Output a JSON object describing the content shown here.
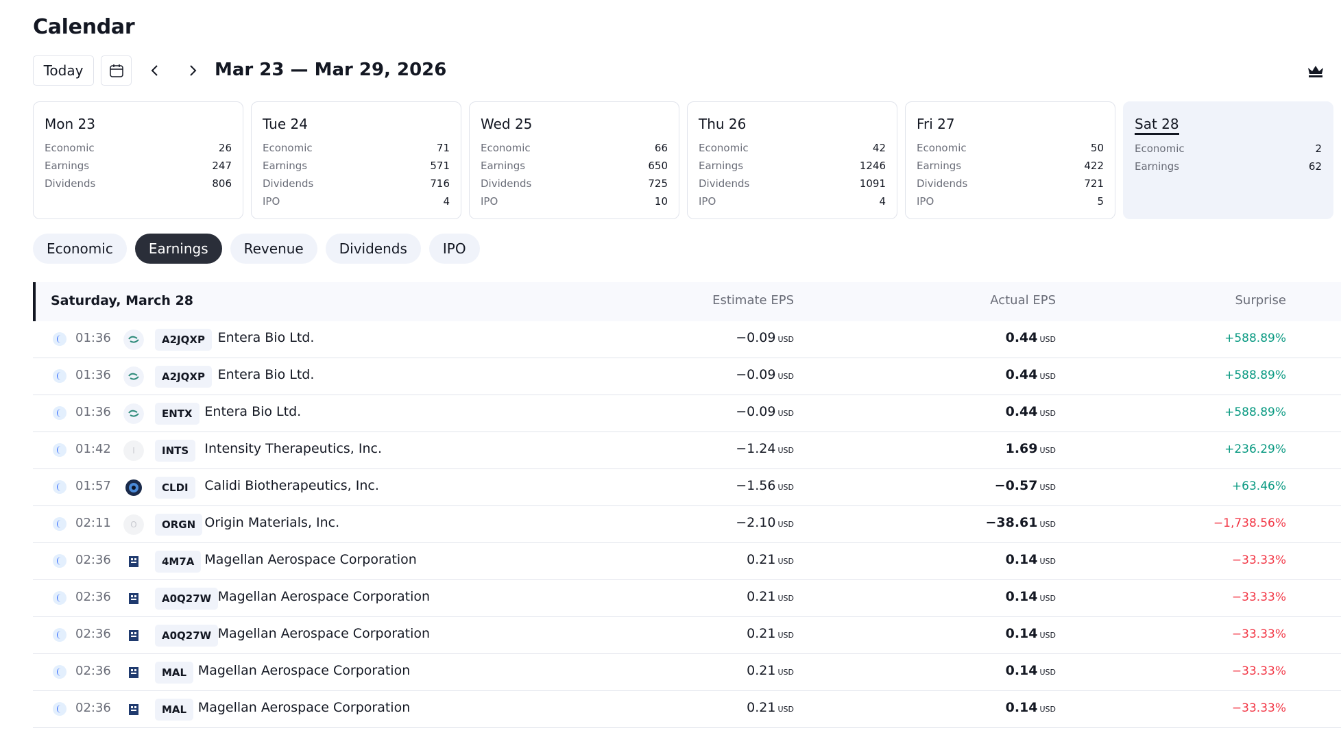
{
  "page_title": "Calendar",
  "toolbar": {
    "today_label": "Today",
    "calendar_icon": "calendar-icon",
    "prev_icon": "chevron-left-icon",
    "next_icon": "chevron-right-icon",
    "date_range": "Mar 23 — Mar 29, 2026",
    "premium_icon": "crown-icon"
  },
  "days": [
    {
      "title": "Mon 23",
      "stats": [
        {
          "name": "Economic",
          "value": "26"
        },
        {
          "name": "Earnings",
          "value": "247"
        },
        {
          "name": "Dividends",
          "value": "806"
        }
      ]
    },
    {
      "title": "Tue 24",
      "stats": [
        {
          "name": "Economic",
          "value": "71"
        },
        {
          "name": "Earnings",
          "value": "571"
        },
        {
          "name": "Dividends",
          "value": "716"
        },
        {
          "name": "IPO",
          "value": "4"
        }
      ]
    },
    {
      "title": "Wed 25",
      "stats": [
        {
          "name": "Economic",
          "value": "66"
        },
        {
          "name": "Earnings",
          "value": "650"
        },
        {
          "name": "Dividends",
          "value": "725"
        },
        {
          "name": "IPO",
          "value": "10"
        }
      ]
    },
    {
      "title": "Thu 26",
      "stats": [
        {
          "name": "Economic",
          "value": "42"
        },
        {
          "name": "Earnings",
          "value": "1246"
        },
        {
          "name": "Dividends",
          "value": "1091"
        },
        {
          "name": "IPO",
          "value": "4"
        }
      ]
    },
    {
      "title": "Fri 27",
      "stats": [
        {
          "name": "Economic",
          "value": "50"
        },
        {
          "name": "Earnings",
          "value": "422"
        },
        {
          "name": "Dividends",
          "value": "721"
        },
        {
          "name": "IPO",
          "value": "5"
        }
      ]
    },
    {
      "title": "Sat 28",
      "active": true,
      "stats": [
        {
          "name": "Economic",
          "value": "2"
        },
        {
          "name": "Earnings",
          "value": "62"
        }
      ]
    }
  ],
  "filters": [
    {
      "label": "Economic",
      "active": false
    },
    {
      "label": "Earnings",
      "active": true
    },
    {
      "label": "Revenue",
      "active": false
    },
    {
      "label": "Dividends",
      "active": false
    },
    {
      "label": "IPO",
      "active": false
    }
  ],
  "table": {
    "date_label": "Saturday, March 28",
    "columns": {
      "estimate": "Estimate EPS",
      "actual": "Actual EPS",
      "surprise": "Surprise"
    },
    "unit": "USD",
    "rows": [
      {
        "time": "01:36",
        "logo": "entera-logo",
        "ticker": "A2JQXP",
        "company": "Entera Bio Ltd.",
        "estimate": "−0.09",
        "actual": "0.44",
        "surprise": "+588.89%",
        "positive": true
      },
      {
        "time": "01:36",
        "logo": "entera-logo",
        "ticker": "A2JQXP",
        "company": "Entera Bio Ltd.",
        "estimate": "−0.09",
        "actual": "0.44",
        "surprise": "+588.89%",
        "positive": true
      },
      {
        "time": "01:36",
        "logo": "entera-logo",
        "ticker": "ENTX",
        "company": "Entera Bio Ltd.",
        "estimate": "−0.09",
        "actual": "0.44",
        "surprise": "+588.89%",
        "positive": true
      },
      {
        "time": "01:42",
        "logo": "placeholder-logo",
        "logo_letter": "I",
        "ticker": "INTS",
        "company": "Intensity Therapeutics, Inc.",
        "estimate": "−1.24",
        "actual": "1.69",
        "surprise": "+236.29%",
        "positive": true
      },
      {
        "time": "01:57",
        "logo": "calidi-logo",
        "ticker": "CLDI",
        "company": "Calidi Biotherapeutics, Inc.",
        "estimate": "−1.56",
        "actual": "−0.57",
        "surprise": "+63.46%",
        "positive": true
      },
      {
        "time": "02:11",
        "logo": "placeholder-logo",
        "logo_letter": "O",
        "ticker": "ORGN",
        "company": "Origin Materials, Inc.",
        "estimate": "−2.10",
        "actual": "−38.61",
        "surprise": "−1,738.56%",
        "positive": false
      },
      {
        "time": "02:36",
        "logo": "magellan-logo",
        "ticker": "4M7A",
        "company": "Magellan Aerospace Corporation",
        "estimate": "0.21",
        "actual": "0.14",
        "surprise": "−33.33%",
        "positive": false
      },
      {
        "time": "02:36",
        "logo": "magellan-logo",
        "ticker": "A0Q27W",
        "company": "Magellan Aerospace Corporation",
        "estimate": "0.21",
        "actual": "0.14",
        "surprise": "−33.33%",
        "positive": false
      },
      {
        "time": "02:36",
        "logo": "magellan-logo",
        "ticker": "A0Q27W",
        "company": "Magellan Aerospace Corporation",
        "estimate": "0.21",
        "actual": "0.14",
        "surprise": "−33.33%",
        "positive": false
      },
      {
        "time": "02:36",
        "logo": "magellan-logo",
        "ticker": "MAL",
        "company": "Magellan Aerospace Corporation",
        "estimate": "0.21",
        "actual": "0.14",
        "surprise": "−33.33%",
        "positive": false
      },
      {
        "time": "02:36",
        "logo": "magellan-logo",
        "ticker": "MAL",
        "company": "Magellan Aerospace Corporation",
        "estimate": "0.21",
        "actual": "0.14",
        "surprise": "−33.33%",
        "positive": false
      }
    ]
  }
}
